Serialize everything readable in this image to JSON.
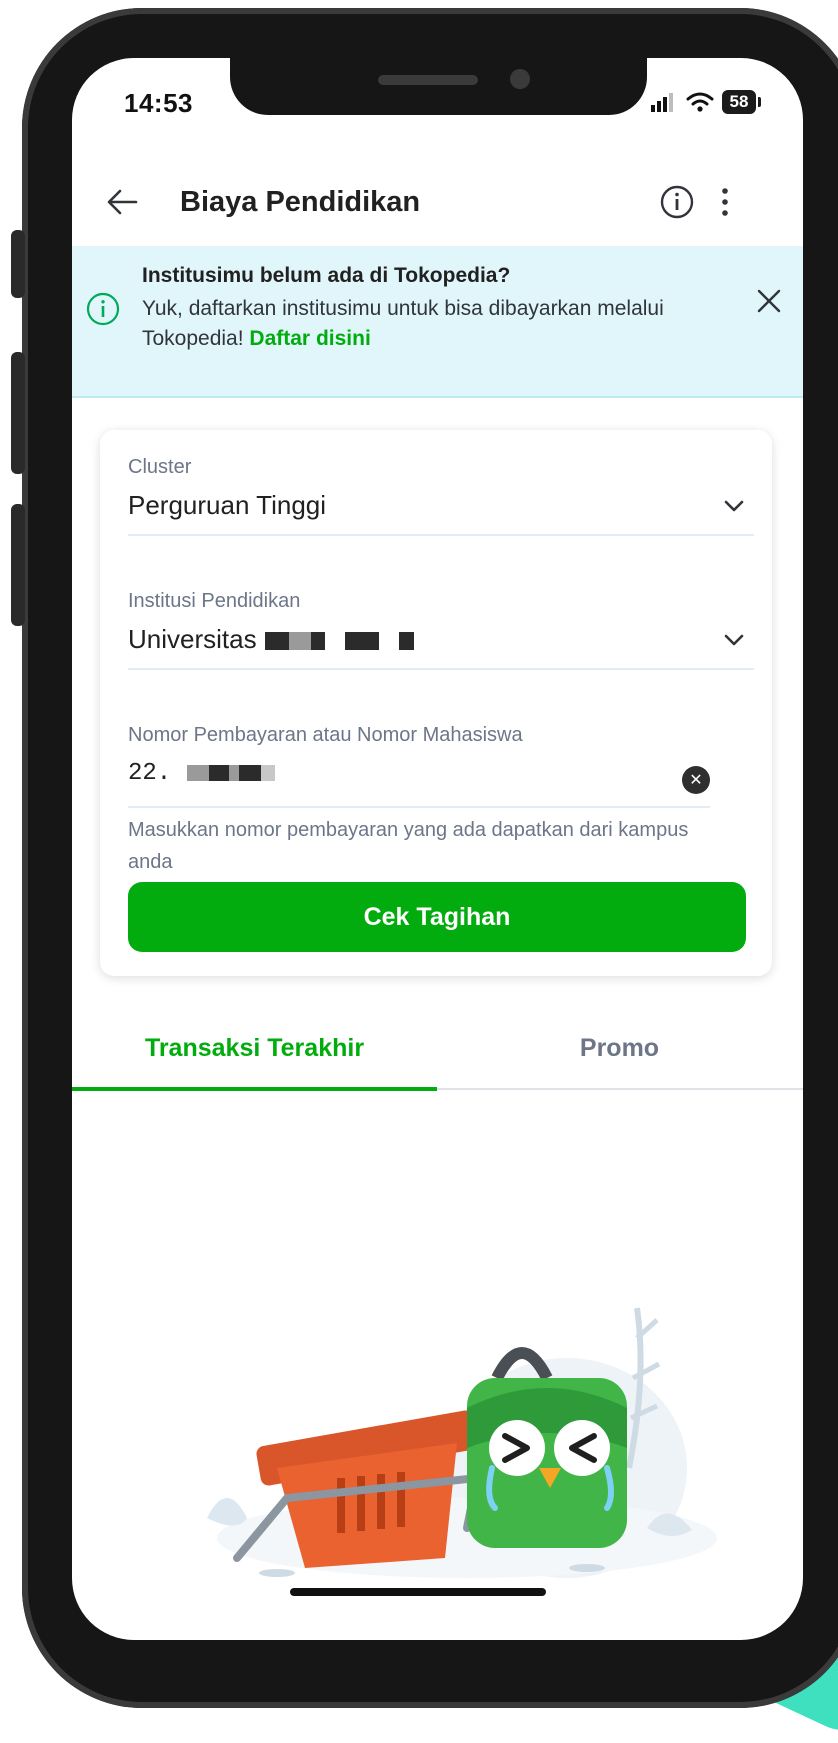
{
  "status_bar": {
    "time": "14:53",
    "battery": "58"
  },
  "header": {
    "title": "Biaya Pendidikan"
  },
  "banner": {
    "title": "Institusimu belum ada di Tokopedia?",
    "text": "Yuk, daftarkan institusimu untuk bisa dibayarkan melalui Tokopedia!",
    "link": "Daftar disini"
  },
  "form": {
    "cluster": {
      "label": "Cluster",
      "value": "Perguruan Tinggi"
    },
    "institution": {
      "label": "Institusi Pendidikan",
      "value": "Universitas"
    },
    "payment_number": {
      "label": "Nomor Pembayaran atau Nomor Mahasiswa",
      "value": "22."
    },
    "helper": "Masukkan nomor pembayaran yang ada dapatkan dari kampus anda",
    "submit": "Cek Tagihan"
  },
  "tabs": [
    {
      "label": "Transaksi Terakhir",
      "active": true
    },
    {
      "label": "Promo",
      "active": false
    }
  ],
  "colors": {
    "brand_green": "#03AC0E",
    "banner_bg": "#E0F6FA"
  }
}
